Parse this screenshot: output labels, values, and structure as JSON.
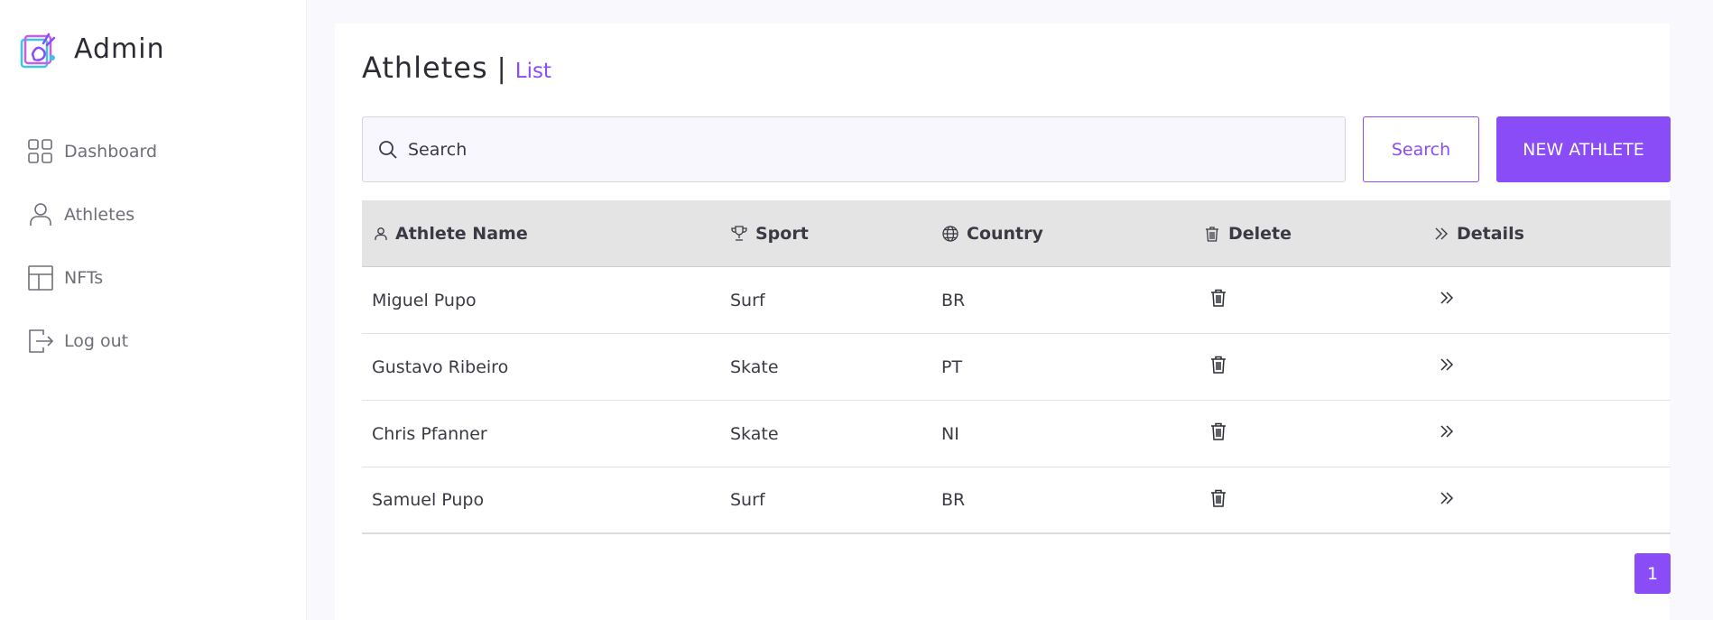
{
  "sidebar": {
    "brand": "Admin",
    "items": [
      {
        "label": "Dashboard",
        "icon": "grid-icon"
      },
      {
        "label": "Athletes",
        "icon": "user-icon"
      },
      {
        "label": "NFTs",
        "icon": "layout-icon"
      },
      {
        "label": "Log out",
        "icon": "logout-icon"
      }
    ]
  },
  "header": {
    "title": "Athletes",
    "separator": "|",
    "subtitle": "List"
  },
  "search": {
    "placeholder": "Search",
    "button_label": "Search"
  },
  "new_button_label": "NEW ATHLETE",
  "table": {
    "columns": [
      "Athlete Name",
      "Sport",
      "Country",
      "Delete",
      "Details"
    ],
    "rows": [
      {
        "name": "Miguel Pupo",
        "sport": "Surf",
        "country": "BR"
      },
      {
        "name": "Gustavo Ribeiro",
        "sport": "Skate",
        "country": "PT"
      },
      {
        "name": "Chris Pfanner",
        "sport": "Skate",
        "country": "NI"
      },
      {
        "name": "Samuel Pupo",
        "sport": "Surf",
        "country": "BR"
      }
    ]
  },
  "pagination": {
    "current": "1"
  },
  "colors": {
    "accent": "#8a4cf6",
    "header_bg": "#e4e4e4"
  }
}
